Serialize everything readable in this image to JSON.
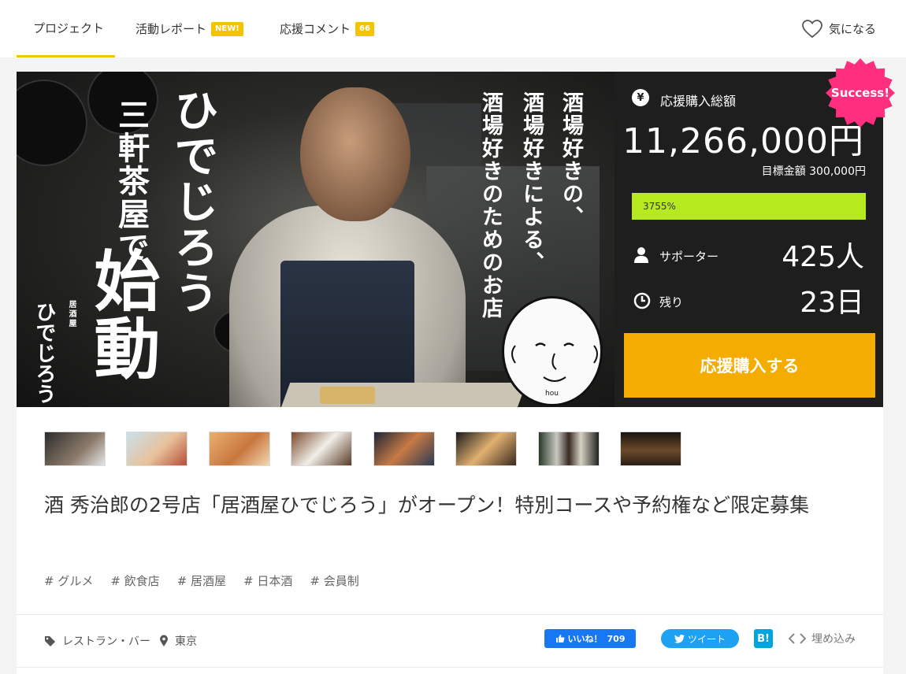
{
  "nav": {
    "tabs": [
      {
        "label": "プロジェクト",
        "badge": ""
      },
      {
        "label": "活動レポート",
        "badge": "NEW!"
      },
      {
        "label": "応援コメント",
        "badge": "66"
      }
    ],
    "favorite_label": "気になる"
  },
  "hero": {
    "art_text": {
      "col1": "ひでじろう",
      "col2": "三軒茶屋で",
      "col3": "始動",
      "logo_small": "居酒屋",
      "logo_name": "ひでじろう",
      "right1": "酒場好きの、",
      "right2": "酒場好きによる、",
      "right3": "酒場好きのためのお店",
      "face_caption": "hou"
    },
    "stats": {
      "total_label": "応援購入総額",
      "total_amount": "11,266,000円",
      "goal_text": "目標金額 300,000円",
      "progress_text": "3755%",
      "progress_percent": 3755,
      "supporters_label": "サポーター",
      "supporters_value": "425人",
      "remaining_label": "残り",
      "remaining_value": "23日",
      "buy_button": "応援購入する",
      "badge": "Success!"
    }
  },
  "gallery": {
    "thumbs": [
      "thumb-main",
      "thumb-sashimi",
      "thumb-pork",
      "thumb-rice",
      "thumb-plate",
      "thumb-dish",
      "thumb-bottles",
      "thumb-interior"
    ]
  },
  "project": {
    "title": "酒 秀治郎の2号店「居酒屋ひでじろう」がオープン！特別コースや予約権など限定募集",
    "tags": [
      "# グルメ",
      "# 飲食店",
      "# 居酒屋",
      "# 日本酒",
      "# 会員制"
    ],
    "category": "レストラン・バー",
    "location": "東京"
  },
  "share": {
    "fb_label": "いいね！",
    "fb_count": "709",
    "tweet_label": "ツイート",
    "hatena_label": "B!",
    "embed_label": "埋め込み"
  },
  "colors": {
    "accent": "#f5c400",
    "buy": "#f5ac00",
    "progress": "#b6ea1f",
    "success": "#ff2e7e",
    "facebook": "#1877f2",
    "twitter": "#1da1f2",
    "hatena": "#00a4de"
  }
}
